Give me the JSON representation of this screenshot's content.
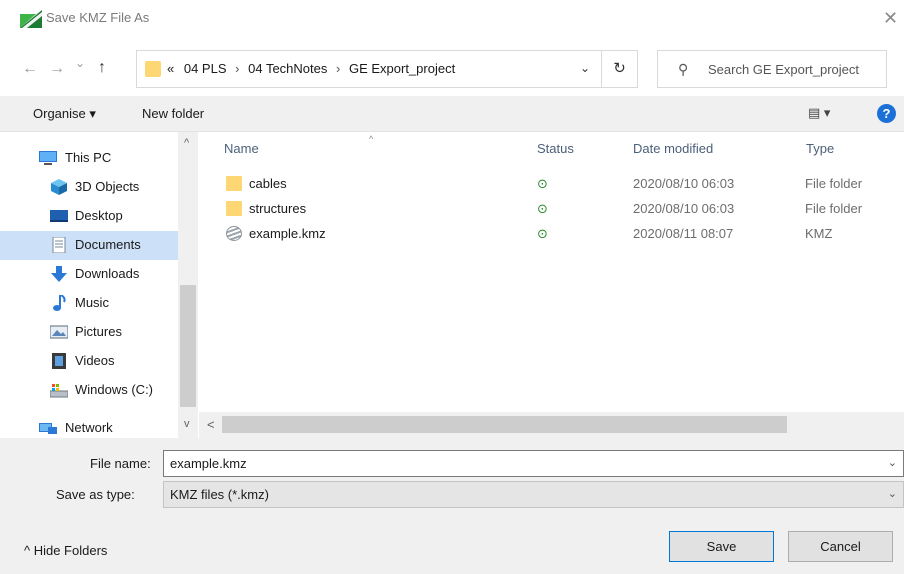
{
  "window": {
    "title": "Save KMZ File As",
    "close_glyph": "✕"
  },
  "nav": {
    "back_glyph": "←",
    "forward_glyph": "→",
    "recent_glyph": "⌄",
    "up_glyph": "↑"
  },
  "address": {
    "overflow_glyph": "«",
    "crumbs": [
      "04 PLS",
      "04 TechNotes",
      "GE Export_project"
    ],
    "separator": "›",
    "dropdown_glyph": "⌄",
    "refresh_glyph": "↻"
  },
  "search": {
    "icon_glyph": "⚲",
    "placeholder": "Search GE Export_project"
  },
  "toolbar": {
    "organise_label": "Organise ▾",
    "new_folder_label": "New folder",
    "view_glyph": "▤ ▾",
    "help_glyph": "?"
  },
  "sidebar": {
    "items": [
      {
        "label": "This PC",
        "icon": "computer-icon"
      },
      {
        "label": "3D Objects",
        "icon": "cube-icon"
      },
      {
        "label": "Desktop",
        "icon": "desktop-icon"
      },
      {
        "label": "Documents",
        "icon": "document-icon",
        "selected": true
      },
      {
        "label": "Downloads",
        "icon": "download-arrow-icon"
      },
      {
        "label": "Music",
        "icon": "music-note-icon"
      },
      {
        "label": "Pictures",
        "icon": "picture-icon"
      },
      {
        "label": "Videos",
        "icon": "film-icon"
      },
      {
        "label": "Windows (C:)",
        "icon": "drive-icon"
      },
      {
        "label": "Network",
        "icon": "network-icon"
      }
    ],
    "scroll_up_glyph": "^",
    "scroll_down_glyph": "v"
  },
  "filelist": {
    "columns": {
      "name": "Name",
      "status": "Status",
      "date": "Date modified",
      "type": "Type"
    },
    "sort_glyph": "^",
    "rows": [
      {
        "name": "cables",
        "status": "⊙",
        "date": "2020/08/10 06:03",
        "type": "File folder",
        "icon": "folder-icon"
      },
      {
        "name": "structures",
        "status": "⊙",
        "date": "2020/08/10 06:03",
        "type": "File folder",
        "icon": "folder-icon"
      },
      {
        "name": "example.kmz",
        "status": "⊙",
        "date": "2020/08/11 08:07",
        "type": "KMZ",
        "icon": "kmz-file-icon"
      }
    ],
    "hscroll_left_glyph": "<"
  },
  "form": {
    "file_name_label": "File name:",
    "file_name_value": "example.kmz",
    "save_type_label": "Save as type:",
    "save_type_value": "KMZ files (*.kmz)",
    "dropdown_glyph": "⌄"
  },
  "footer": {
    "hide_folders_label": "^  Hide Folders",
    "save_label": "Save",
    "cancel_label": "Cancel"
  }
}
